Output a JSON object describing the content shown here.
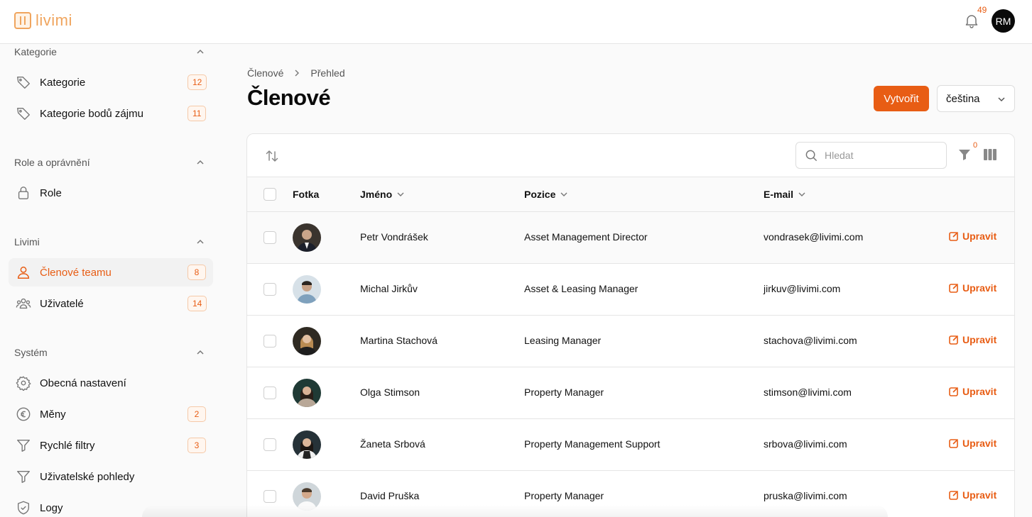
{
  "app": {
    "logo_text": "livimi",
    "notification_count": "49",
    "user_initials": "RM"
  },
  "sidebar": {
    "sections": [
      {
        "title": "Kategorie",
        "items": [
          {
            "label": "Kategorie",
            "badge": "12",
            "icon": "tag-icon"
          },
          {
            "label": "Kategorie bodů zájmu",
            "badge": "11",
            "icon": "tag-icon"
          }
        ]
      },
      {
        "title": "Role a oprávnění",
        "items": [
          {
            "label": "Role",
            "badge": "",
            "icon": "lock-icon"
          }
        ]
      },
      {
        "title": "Livimi",
        "items": [
          {
            "label": "Členové teamu",
            "badge": "8",
            "icon": "user-icon",
            "active": true
          },
          {
            "label": "Uživatelé",
            "badge": "14",
            "icon": "users-icon"
          }
        ]
      },
      {
        "title": "Systém",
        "items": [
          {
            "label": "Obecná nastavení",
            "badge": "",
            "icon": "gear-icon"
          },
          {
            "label": "Měny",
            "badge": "2",
            "icon": "euro-icon"
          },
          {
            "label": "Rychlé filtry",
            "badge": "3",
            "icon": "funnel-icon"
          },
          {
            "label": "Uživatelské pohledy",
            "badge": "",
            "icon": "funnel-icon"
          },
          {
            "label": "Logy",
            "badge": "",
            "icon": "shield-icon"
          }
        ]
      }
    ]
  },
  "breadcrumb": {
    "parent": "Členové",
    "current": "Přehled"
  },
  "page": {
    "title": "Členové",
    "create_label": "Vytvořit",
    "language": "čeština"
  },
  "toolbar": {
    "search_placeholder": "Hledat",
    "filter_count": "0"
  },
  "table": {
    "headers": {
      "photo": "Fotka",
      "name": "Jméno",
      "position": "Pozice",
      "email": "E-mail"
    },
    "edit_label": "Upravit",
    "rows": [
      {
        "name": "Petr Vondrášek",
        "position": "Asset Management Director",
        "email": "vondrasek@livimi.com"
      },
      {
        "name": "Michal Jirkův",
        "position": "Asset & Leasing Manager",
        "email": "jirkuv@livimi.com"
      },
      {
        "name": "Martina Stachová",
        "position": "Leasing Manager",
        "email": "stachova@livimi.com"
      },
      {
        "name": "Olga Stimson",
        "position": "Property Manager",
        "email": "stimson@livimi.com"
      },
      {
        "name": "Žaneta Srbová",
        "position": "Property Management Support",
        "email": "srbova@livimi.com"
      },
      {
        "name": "David Pruška",
        "position": "Property Manager",
        "email": "pruska@livimi.com"
      }
    ]
  },
  "colors": {
    "accent": "#e85d14",
    "logo": "#f0a55e"
  }
}
